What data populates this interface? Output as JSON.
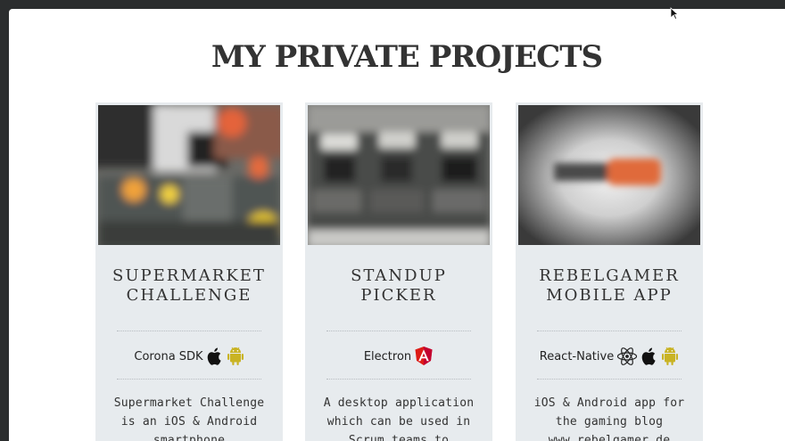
{
  "page": {
    "title": "MY PRIVATE PROJECTS"
  },
  "projects": [
    {
      "title_line1": "SUPERMARKET",
      "title_line2": "CHALLENGE",
      "tech_label": "Corona SDK",
      "tech_icons": [
        "apple-icon",
        "android-icon"
      ],
      "description": "Supermarket Challenge is an iOS & Android smartphone"
    },
    {
      "title_line1": "STANDUP",
      "title_line2": "PICKER",
      "tech_label": "Electron",
      "tech_icons": [
        "angular-icon"
      ],
      "description": "A desktop application which can be used in Scrum teams to"
    },
    {
      "title_line1": "REBELGAMER",
      "title_line2": "MOBILE APP",
      "tech_label": "React-Native",
      "tech_icons": [
        "react-icon",
        "apple-icon",
        "android-icon"
      ],
      "description": "iOS & Android app for the gaming blog www.rebelgamer.de"
    }
  ],
  "colors": {
    "card_bg": "#e7ebee",
    "angular": "#dd1b16",
    "android": "#c9b324",
    "accent_orange": "#e06a3a"
  }
}
